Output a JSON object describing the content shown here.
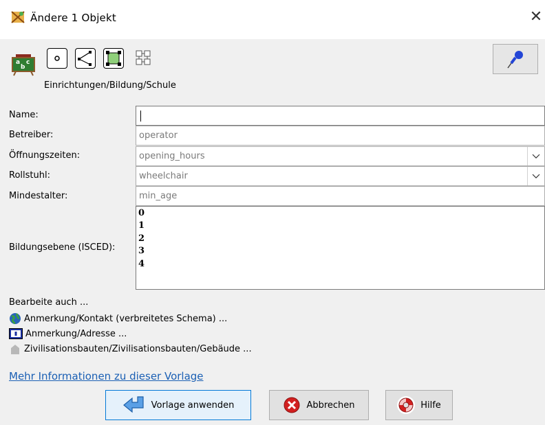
{
  "window": {
    "title": "Ändere 1 Objekt",
    "close_glyph": "✕"
  },
  "preset": {
    "path": "Einrichtungen/Bildung/Schule",
    "icon": "school-blackboard-icon"
  },
  "type_icons": [
    "node-icon",
    "way-icon",
    "closed-way-icon",
    "relation-icon"
  ],
  "fields": {
    "name": {
      "label": "Name:",
      "value": ""
    },
    "operator": {
      "label": "Betreiber:",
      "placeholder": "operator"
    },
    "opening_hours": {
      "label": "Öffnungszeiten:",
      "placeholder": "opening_hours"
    },
    "wheelchair": {
      "label": "Rollstuhl:",
      "placeholder": "wheelchair"
    },
    "min_age": {
      "label": "Mindestalter:",
      "placeholder": "min_age"
    },
    "isced": {
      "label": "Bildungsebene (ISCED):",
      "options": [
        "0",
        "1",
        "2",
        "3",
        "4"
      ]
    }
  },
  "edit_also": {
    "label": "Bearbeite auch ...",
    "items": [
      {
        "label": "Anmerkung/Kontakt (verbreitetes Schema) ...",
        "icon": "globe-icon"
      },
      {
        "label": "Anmerkung/Adresse ...",
        "icon": "address-card-icon"
      },
      {
        "label": "Zivilisationsbauten/Zivilisationsbauten/Gebäude ...",
        "icon": "building-icon"
      }
    ]
  },
  "more_info": "Mehr Informationen zu dieser Vorlage",
  "buttons": {
    "apply": "Vorlage anwenden",
    "cancel": "Abbrechen",
    "help": "Hilfe"
  },
  "colors": {
    "link": "#1a5fb4",
    "primary_border": "#0078d7",
    "cancel_red": "#d22020"
  }
}
